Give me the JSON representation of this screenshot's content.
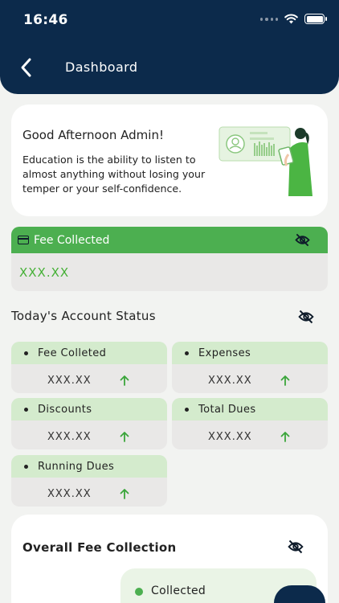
{
  "status_bar": {
    "time": "16:46",
    "icons": [
      "signal-dots-icon",
      "wifi-icon",
      "battery-icon"
    ]
  },
  "header": {
    "title": "Dashboard",
    "back_icon": "chevron-left-icon",
    "color": "#0c2a4b"
  },
  "greeting": {
    "title": "Good Afternoon Admin!",
    "quote": "Education is the ability to listen to almost anything without losing your temper or your self-confidence."
  },
  "fee_collected": {
    "label": "Fee Collected",
    "amount": "XXX.XX",
    "icon": "credit-card-icon",
    "toggle_icon": "eye-off-icon",
    "color": "#4caf50"
  },
  "account_status": {
    "title": "Today's Account Status",
    "toggle_icon": "eye-off-icon",
    "items": [
      {
        "label": "Fee Colleted",
        "value": "XXX.XX",
        "trend": "up-arrow-icon"
      },
      {
        "label": "Expenses",
        "value": "XXX.XX",
        "trend": "up-arrow-icon"
      },
      {
        "label": "Discounts",
        "value": "XXX.XX",
        "trend": "up-arrow-icon"
      },
      {
        "label": "Total Dues",
        "value": "XXX.XX",
        "trend": "up-arrow-icon"
      },
      {
        "label": "Running Dues",
        "value": "XXX.XX",
        "trend": "up-arrow-icon"
      }
    ]
  },
  "overall": {
    "title": "Overall Fee Collection",
    "toggle_icon": "eye-off-icon",
    "legend": [
      {
        "label": "Collected",
        "color": "#4caf50"
      }
    ]
  }
}
